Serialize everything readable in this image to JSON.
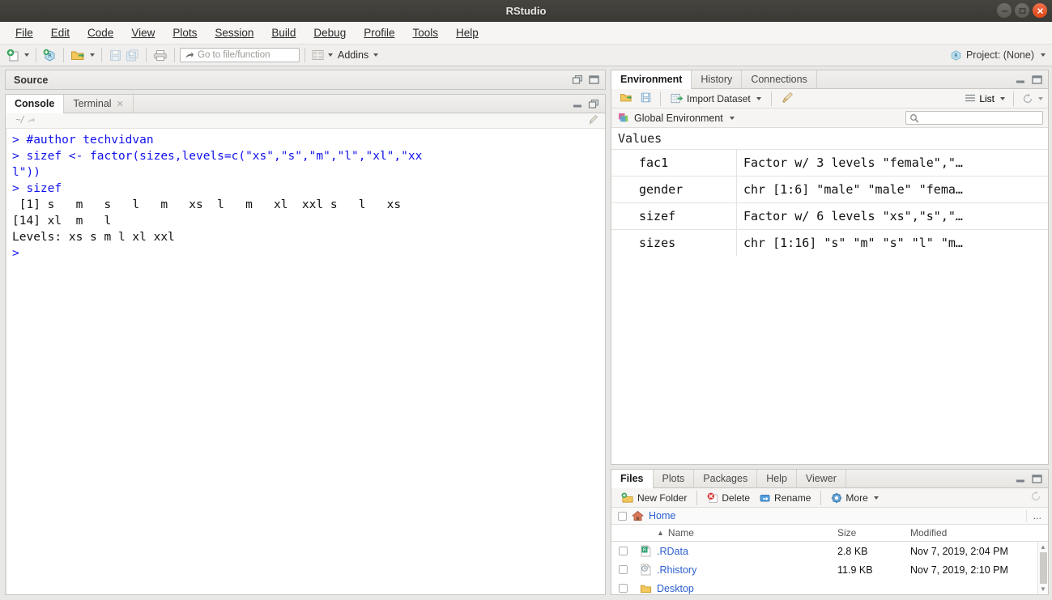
{
  "window": {
    "title": "RStudio",
    "minimize_label": "−",
    "maximize_label": "□",
    "close_label": "×"
  },
  "menubar": {
    "items": [
      {
        "label": "File"
      },
      {
        "label": "Edit"
      },
      {
        "label": "Code"
      },
      {
        "label": "View"
      },
      {
        "label": "Plots"
      },
      {
        "label": "Session"
      },
      {
        "label": "Build"
      },
      {
        "label": "Debug"
      },
      {
        "label": "Profile"
      },
      {
        "label": "Tools"
      },
      {
        "label": "Help"
      }
    ]
  },
  "toolbar": {
    "goto_placeholder": "Go to file/function",
    "addins_label": "Addins",
    "project_label": "Project: (None)"
  },
  "source_pane": {
    "title": "Source"
  },
  "console_pane": {
    "tabs": [
      {
        "label": "Console",
        "active": true,
        "closable": false
      },
      {
        "label": "Terminal",
        "active": false,
        "closable": true
      }
    ],
    "path": "~/",
    "lines": [
      {
        "type": "cmd",
        "text": "> #author techvidvan"
      },
      {
        "type": "cmd",
        "text": "> sizef <- factor(sizes,levels=c(\"xs\",\"s\",\"m\",\"l\",\"xl\",\"xx"
      },
      {
        "type": "cmd",
        "text": "l\"))"
      },
      {
        "type": "cmd",
        "text": "> sizef"
      },
      {
        "type": "out",
        "text": " [1] s   m   s   l   m   xs  l   m   xl  xxl s   l   xs "
      },
      {
        "type": "out",
        "text": "[14] xl  m   l  "
      },
      {
        "type": "out",
        "text": "Levels: xs s m l xl xxl"
      },
      {
        "type": "cmd",
        "text": "> "
      }
    ]
  },
  "environment_pane": {
    "tabs": [
      {
        "label": "Environment",
        "active": true
      },
      {
        "label": "History",
        "active": false
      },
      {
        "label": "Connections",
        "active": false
      }
    ],
    "toolbar": {
      "import_dataset_label": "Import Dataset",
      "view_mode_label": "List"
    },
    "scope_label": "Global Environment",
    "search_value": "",
    "section_title": "Values",
    "rows": [
      {
        "name": "fac1",
        "value": "Factor w/ 3 levels \"female\",\"…"
      },
      {
        "name": "gender",
        "value": "chr [1:6] \"male\" \"male\" \"fema…"
      },
      {
        "name": "sizef",
        "value": "Factor w/ 6 levels \"xs\",\"s\",\"…"
      },
      {
        "name": "sizes",
        "value": "chr [1:16] \"s\" \"m\" \"s\" \"l\" \"m…"
      }
    ]
  },
  "files_pane": {
    "tabs": [
      {
        "label": "Files",
        "active": true
      },
      {
        "label": "Plots",
        "active": false
      },
      {
        "label": "Packages",
        "active": false
      },
      {
        "label": "Help",
        "active": false
      },
      {
        "label": "Viewer",
        "active": false
      }
    ],
    "toolbar": {
      "new_folder_label": "New Folder",
      "delete_label": "Delete",
      "rename_label": "Rename",
      "more_label": "More"
    },
    "breadcrumb": "Home",
    "breadcrumb_overflow": "...",
    "columns": {
      "name": "Name",
      "size": "Size",
      "modified": "Modified"
    },
    "sort_indicator": "▲",
    "rows": [
      {
        "icon": "rdata-file-icon",
        "name": ".RData",
        "size": "2.8 KB",
        "modified": "Nov 7, 2019, 2:04 PM"
      },
      {
        "icon": "history-file-icon",
        "name": ".Rhistory",
        "size": "11.9 KB",
        "modified": "Nov 7, 2019, 2:10 PM"
      },
      {
        "icon": "folder-icon",
        "name": "Desktop",
        "size": "",
        "modified": ""
      }
    ]
  },
  "colors": {
    "titlebar": "#3a3935",
    "close_button": "#dd4814",
    "console_command": "#1111ee",
    "link": "#2b5fcf",
    "panel_border": "#c8c6c2"
  }
}
